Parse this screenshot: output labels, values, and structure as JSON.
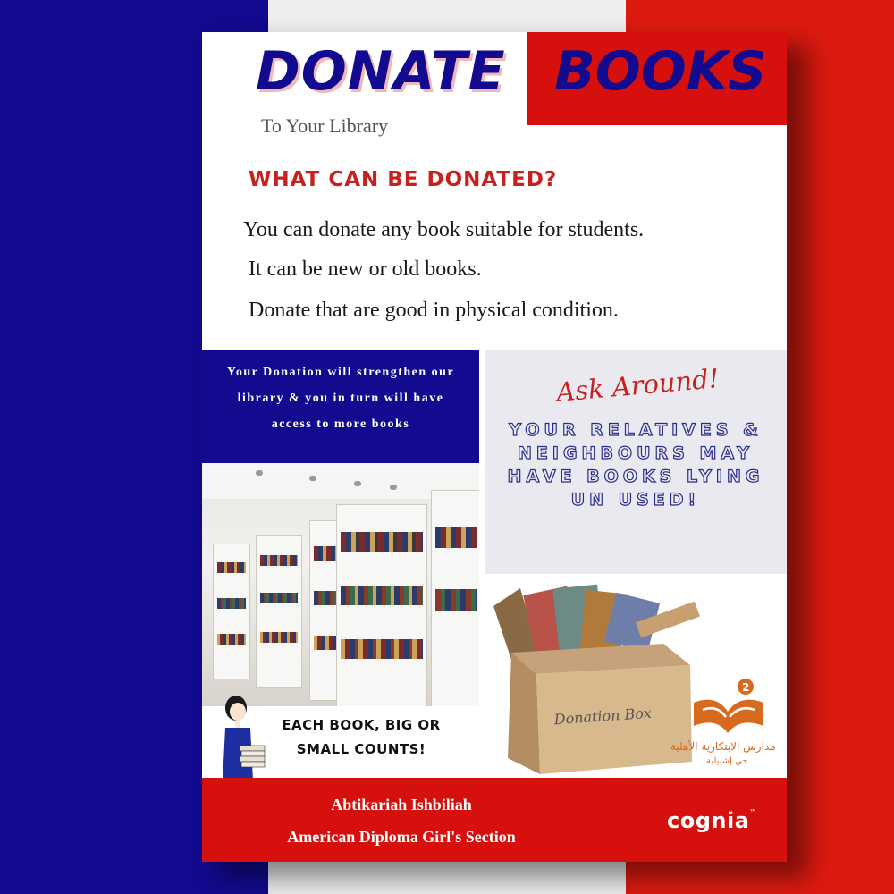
{
  "poster": {
    "title_left": "DONATE",
    "title_right": "BOOKS",
    "subtitle": "To Your Library",
    "heading": "WHAT CAN BE DONATED?",
    "lines": [
      "You can donate any book suitable for students.",
      "It can be new or old books.",
      "Donate that are good in physical condition."
    ],
    "donation_text": "Your Donation will strengthen our library & you in turn will have access to more books",
    "ask_title": "Ask Around!",
    "ask_body": "YOUR RELATIVES & NEIGHBOURS MAY HAVE BOOKS LYING UN USED!",
    "box_label": "Donation Box",
    "counts_line1": "EACH BOOK, BIG OR",
    "counts_line2": "SMALL COUNTS!",
    "logo_number": "2",
    "logo_name": "مدارس الابتكارية الأهلية",
    "logo_sub": "حي إشبيلية",
    "footer_line1": "Abtikariah Ishbiliah",
    "footer_line2": "American Diploma Girl's Section",
    "footer_brand": "cognia",
    "footer_brand_mark": "™"
  },
  "colors": {
    "blue": "#120a8f",
    "red": "#d5100d",
    "white": "#eeeeee",
    "logo_orange": "#d86a1f"
  }
}
